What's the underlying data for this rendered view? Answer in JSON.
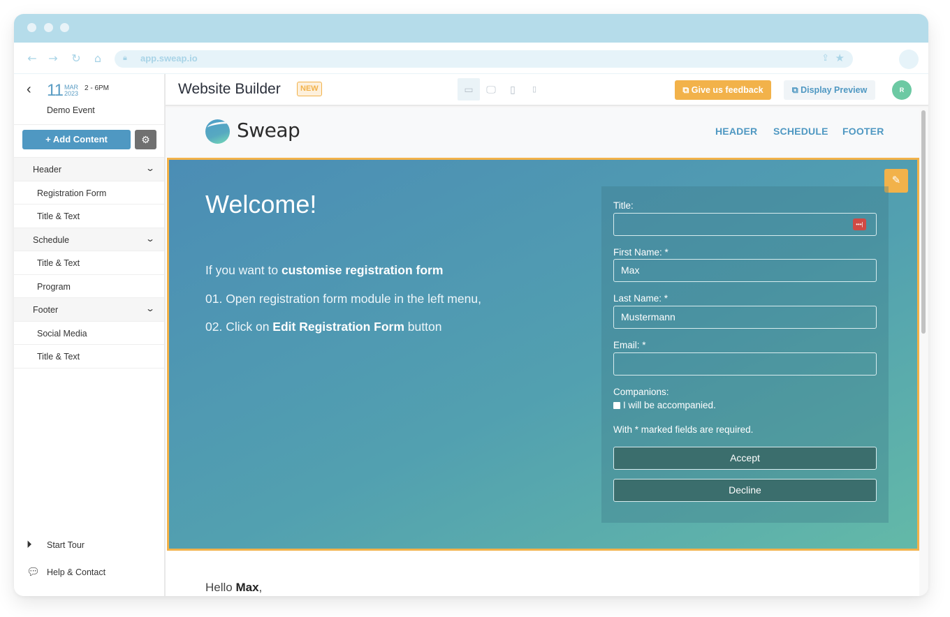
{
  "browser": {
    "url": "app.sweap.io",
    "icons": {
      "back": "arrow-left-icon",
      "forward": "arrow-right-icon",
      "reload": "reload-icon",
      "home": "home-icon",
      "lock": "lock-icon",
      "share": "share-icon",
      "bookmark": "star-icon"
    }
  },
  "sidebar": {
    "back_icon": "‹",
    "event": {
      "day": "11",
      "month": "MAR",
      "year": "2023",
      "time": "2 - 6PM",
      "name": "Demo Event"
    },
    "add_content_label": "+ Add Content",
    "settings_icon": "gear-icon",
    "groups": [
      {
        "label": "Header",
        "items": [
          "Registration Form",
          "Title & Text"
        ]
      },
      {
        "label": "Schedule",
        "items": [
          "Title & Text",
          "Program"
        ]
      },
      {
        "label": "Footer",
        "items": [
          "Social Media",
          "Title & Text"
        ]
      }
    ],
    "footer": {
      "start_tour": "Start Tour",
      "help_contact": "Help & Contact"
    }
  },
  "topbar": {
    "title": "Website Builder",
    "badge": "NEW",
    "devices": [
      "full-width",
      "desktop",
      "tablet",
      "mobile"
    ],
    "active_device": "full-width",
    "feedback_label": "Give us feedback",
    "preview_label": "Display Preview",
    "avatar_initial": "R"
  },
  "site": {
    "logo_text": "Sweap",
    "nav_links": [
      "HEADER",
      "SCHEDULE",
      "FOOTER"
    ],
    "hero": {
      "heading": "Welcome!",
      "line1_prefix": "If you want to ",
      "line1_bold": "customise registration form",
      "line2": "01. Open registration form module in the left menu,",
      "line3_prefix": "02. Click on ",
      "line3_bold": "Edit Registration Form",
      "line3_suffix": " button"
    },
    "form": {
      "title_label": "Title:",
      "title_value": "",
      "first_name_label": "First Name: *",
      "first_name_value": "Max",
      "last_name_label": "Last Name: *",
      "last_name_value": "Mustermann",
      "email_label": "Email: *",
      "email_value": "",
      "companions_label": "Companions:",
      "companions_checkbox": "I will be accompanied.",
      "companions_checked": false,
      "required_note": "With * marked fields are required.",
      "accept_label": "Accept",
      "decline_label": "Decline"
    },
    "greeting_prefix": "Hello ",
    "greeting_name": "Max",
    "greeting_suffix": ","
  },
  "colors": {
    "brand_blue": "#4f98c2",
    "accent_orange": "#f2b24a",
    "avatar_green": "#6cc9a3",
    "titlebar": "#b5dcea"
  }
}
